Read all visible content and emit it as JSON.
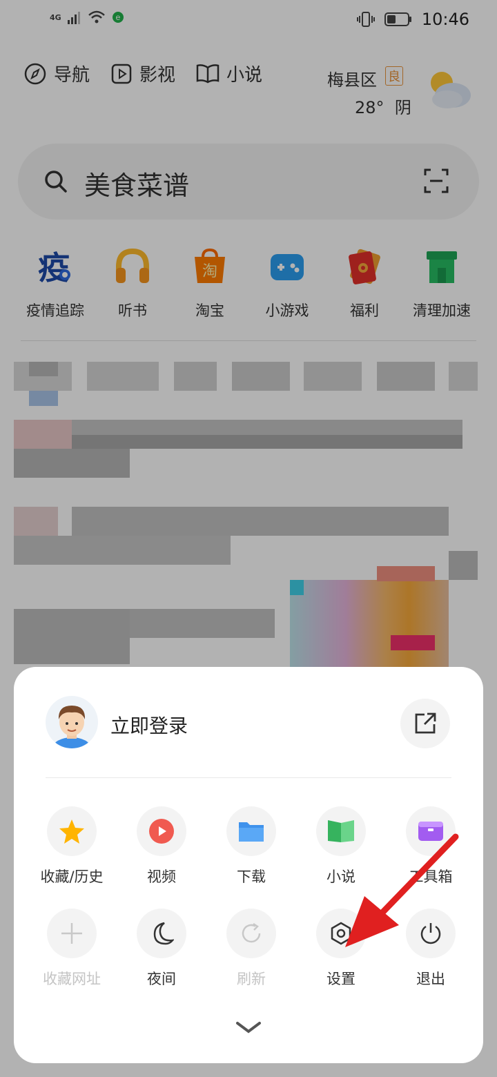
{
  "status_bar": {
    "network": "4G",
    "time": "10:46"
  },
  "top_nav": [
    {
      "label": "导航",
      "icon": "compass-icon"
    },
    {
      "label": "影视",
      "icon": "play-icon"
    },
    {
      "label": "小说",
      "icon": "book-icon"
    }
  ],
  "weather": {
    "location": "梅县区",
    "aqi": "良",
    "temperature": "28°",
    "condition": "阴"
  },
  "search": {
    "placeholder": "美食菜谱"
  },
  "shortcuts": [
    {
      "label": "疫情追踪",
      "glyph": "疫"
    },
    {
      "label": "听书"
    },
    {
      "label": "淘宝",
      "glyph": "淘"
    },
    {
      "label": "小游戏"
    },
    {
      "label": "福利"
    },
    {
      "label": "清理加速"
    }
  ],
  "menu": {
    "login_label": "立即登录",
    "row1": [
      {
        "label": "收藏/历史",
        "icon": "star-icon"
      },
      {
        "label": "视频",
        "icon": "video-icon"
      },
      {
        "label": "下载",
        "icon": "folder-icon"
      },
      {
        "label": "小说",
        "icon": "book-icon"
      },
      {
        "label": "工具箱",
        "icon": "toolbox-icon"
      }
    ],
    "row2": [
      {
        "label": "收藏网址",
        "icon": "plus-icon",
        "enabled": false
      },
      {
        "label": "夜间",
        "icon": "moon-icon",
        "enabled": true
      },
      {
        "label": "刷新",
        "icon": "refresh-icon",
        "enabled": false
      },
      {
        "label": "设置",
        "icon": "settings-icon",
        "enabled": true
      },
      {
        "label": "退出",
        "icon": "power-icon",
        "enabled": true
      }
    ]
  },
  "colors": {
    "accent_red": "#e02020",
    "star": "#ffb400",
    "video": "#f05a50",
    "folder": "#4b9ef5",
    "book": "#4cc070",
    "toolbox": "#a25cf0"
  }
}
